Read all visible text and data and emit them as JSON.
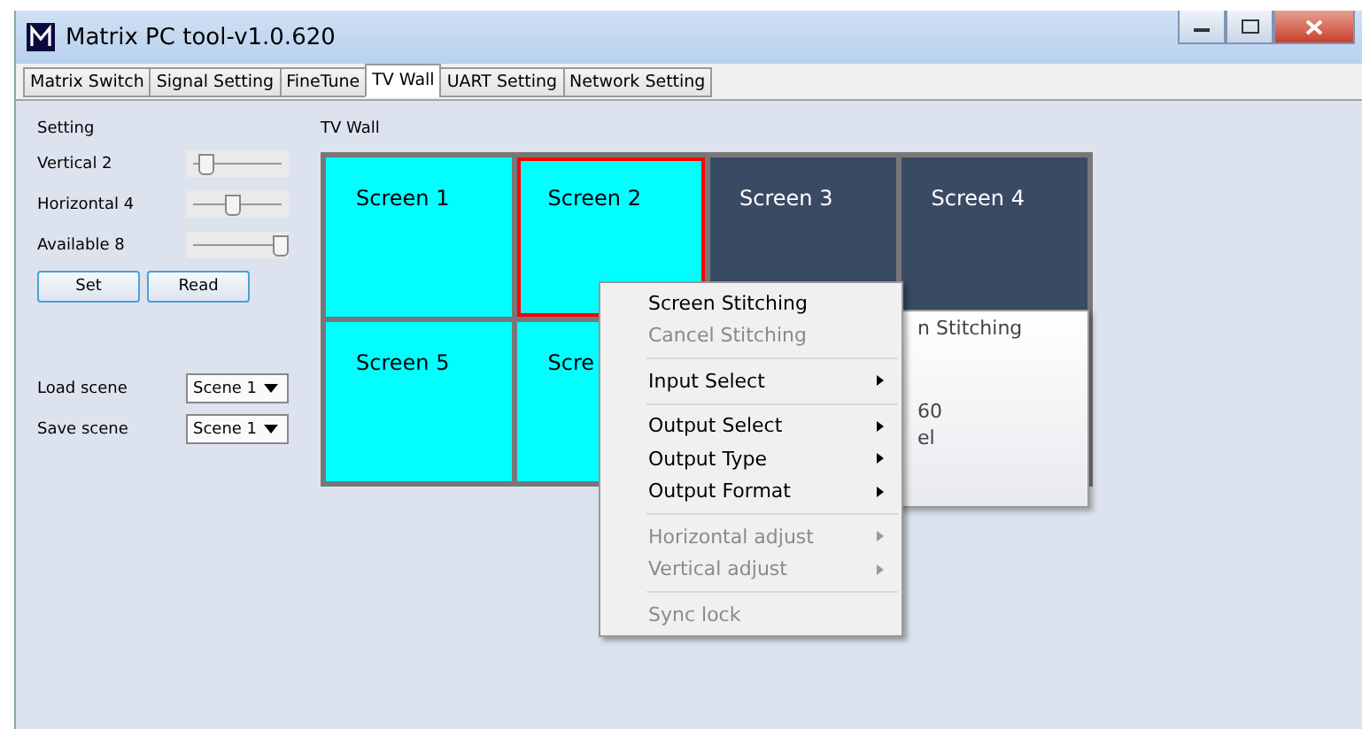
{
  "window": {
    "title": "Matrix PC tool-v1.0.620"
  },
  "tabs": [
    {
      "label": "Matrix Switch",
      "selected": false
    },
    {
      "label": "Signal Setting",
      "selected": false
    },
    {
      "label": "FineTune",
      "selected": false
    },
    {
      "label": "TV Wall",
      "selected": true
    },
    {
      "label": "UART Setting",
      "selected": false
    },
    {
      "label": "Network Setting",
      "selected": false
    }
  ],
  "setting": {
    "title": "Setting",
    "sliders": [
      {
        "label": "Vertical 2",
        "level": 0.15
      },
      {
        "label": "Horizontal 4",
        "level": 0.45
      },
      {
        "label": "Available 8",
        "level": 1
      }
    ],
    "buttons": [
      "Set",
      "Read"
    ],
    "scenes": [
      {
        "label": "Load scene",
        "value": "Scene 1"
      },
      {
        "label": "Save scene",
        "value": "Scene 1"
      }
    ]
  },
  "tv_wall": {
    "title": "TV Wall",
    "screens": [
      {
        "label": "Screen 1",
        "color": "#00ffff",
        "selected": false
      },
      {
        "label": "Screen 2",
        "color": "#00ffff",
        "selected": true
      },
      {
        "label": "Screen 3",
        "color": "#394a63",
        "selected": false
      },
      {
        "label": "Screen 4",
        "color": "#394a63",
        "selected": false
      },
      {
        "label": "Screen 5",
        "color": "#00ffff",
        "selected": false
      },
      {
        "label": "Scre",
        "color": "#00ffff",
        "selected": false
      }
    ]
  },
  "background_popup": {
    "groups": [
      [
        "n Stitching"
      ],
      [
        "60",
        "el"
      ]
    ]
  },
  "context_menu": {
    "groups": [
      [
        {
          "label": "Screen Stitching",
          "disabled": false,
          "submenu": false
        },
        {
          "label": "Cancel Stitching",
          "disabled": true,
          "submenu": false
        }
      ],
      [
        {
          "label": "Input Select",
          "disabled": false,
          "submenu": true
        }
      ],
      [
        {
          "label": "Output Select",
          "disabled": false,
          "submenu": true
        },
        {
          "label": "Output Type",
          "disabled": false,
          "submenu": true
        },
        {
          "label": "Output Format",
          "disabled": false,
          "submenu": true
        }
      ],
      [
        {
          "label": "Horizontal adjust",
          "disabled": true,
          "submenu": true
        },
        {
          "label": "Vertical adjust",
          "disabled": true,
          "submenu": true
        }
      ],
      [
        {
          "label": "Sync lock",
          "disabled": true,
          "submenu": false
        }
      ]
    ]
  }
}
